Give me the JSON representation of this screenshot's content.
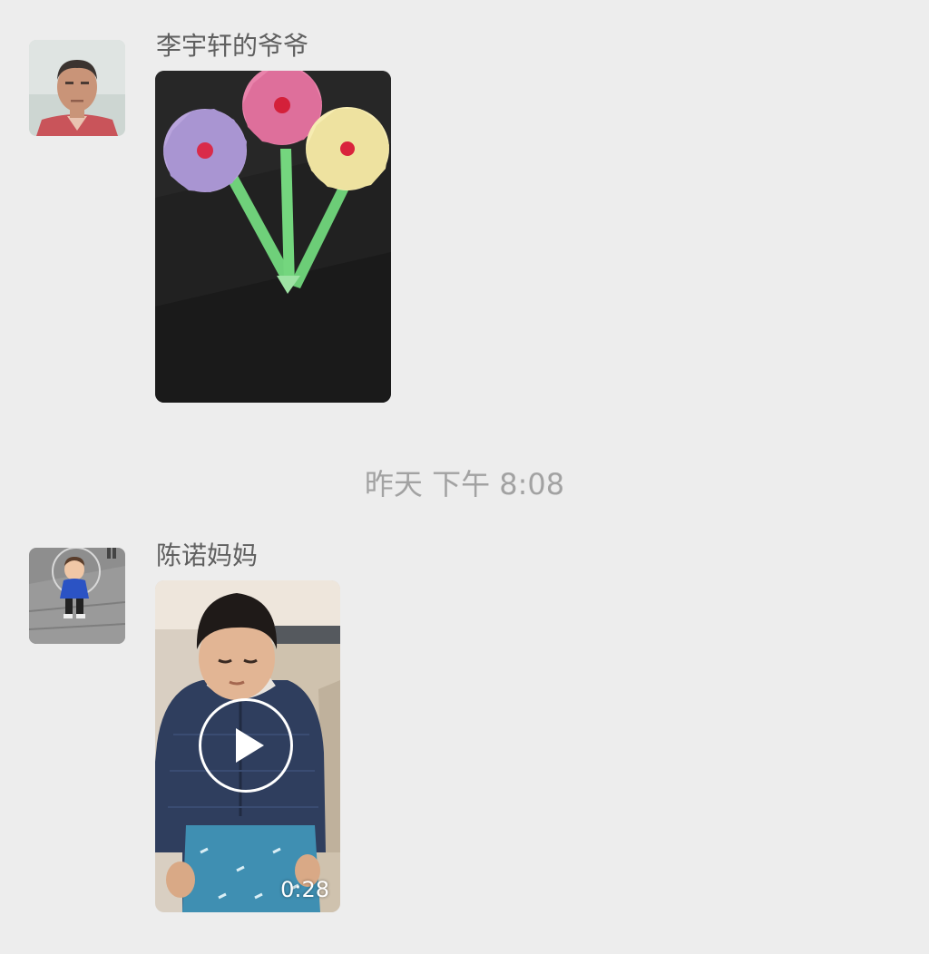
{
  "messages": [
    {
      "sender": "李宇轩的爷爷",
      "type": "image",
      "avatar_icon": "elderly-man-avatar",
      "content_icon": "paper-flowers-photo"
    },
    {
      "sender": "陈诺妈妈",
      "type": "video",
      "avatar_icon": "toddler-avatar",
      "content_icon": "boy-on-sofa-video",
      "duration": "0:28"
    }
  ],
  "timestamp": "昨天 下午 8:08",
  "colors": {
    "background": "#ededed",
    "sender_text": "#5f5f5f",
    "timestamp_text": "#a2a2a2"
  }
}
